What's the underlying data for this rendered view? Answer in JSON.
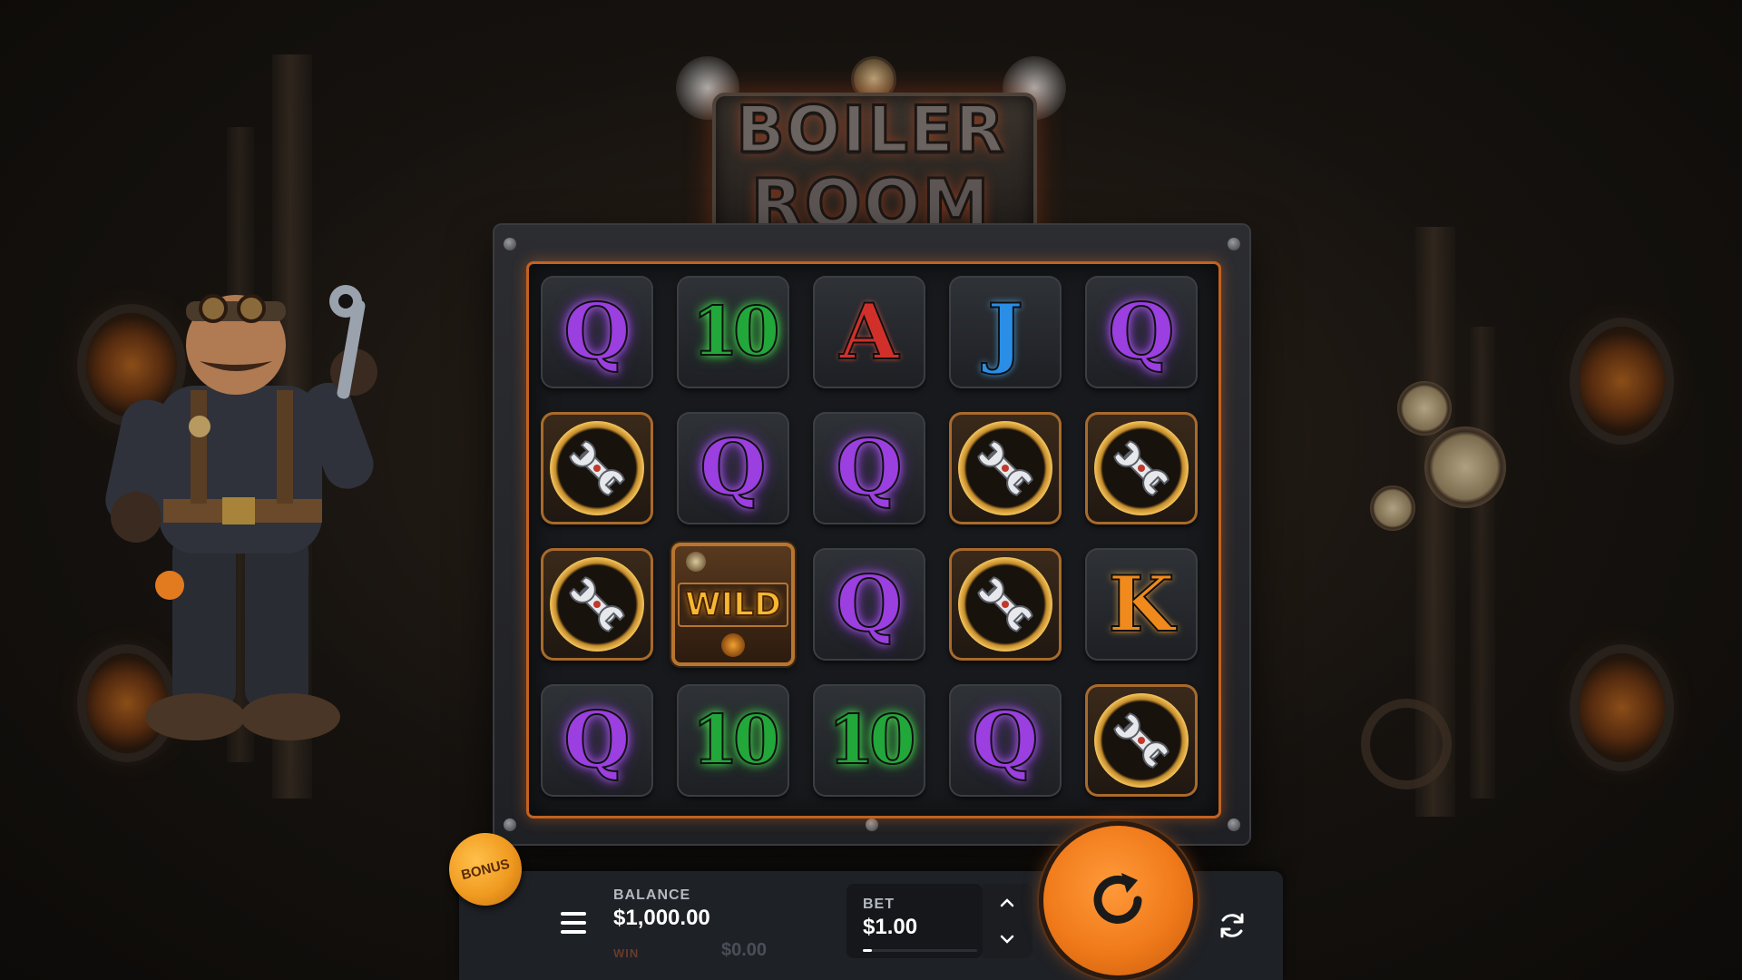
{
  "game": {
    "logo_line1": "BOILER",
    "logo_line2": "ROOM"
  },
  "reels": [
    [
      "Q",
      "10",
      "A",
      "J",
      "Q"
    ],
    [
      "wrench",
      "Q",
      "Q",
      "wrench",
      "wrench"
    ],
    [
      "wrench",
      "WILD",
      "Q",
      "wrench",
      "K"
    ],
    [
      "Q",
      "10",
      "10",
      "Q",
      "wrench"
    ]
  ],
  "controls": {
    "bonus_label": "BONUS",
    "balance_label": "BALANCE",
    "balance_value": "$1,000.00",
    "win_label": "WIN",
    "win_value": "$0.00",
    "bet_label": "BET",
    "bet_value": "$1.00",
    "bet_level_fraction": 0.08
  },
  "icons": {
    "menu": "hamburger-menu-icon",
    "spin": "spin-arrow-icon",
    "autoplay": "autoplay-refresh-icon",
    "bet_up": "chevron-up-icon",
    "bet_down": "chevron-down-icon"
  },
  "colors": {
    "frame_accent": "#c4621f",
    "spin_button": "#f07a1a",
    "queen": "#9b3fe0",
    "ten": "#22a83a",
    "ace": "#d1302a",
    "jack": "#2a8ee6",
    "king": "#f08a1c",
    "wild": "#f7b830"
  }
}
